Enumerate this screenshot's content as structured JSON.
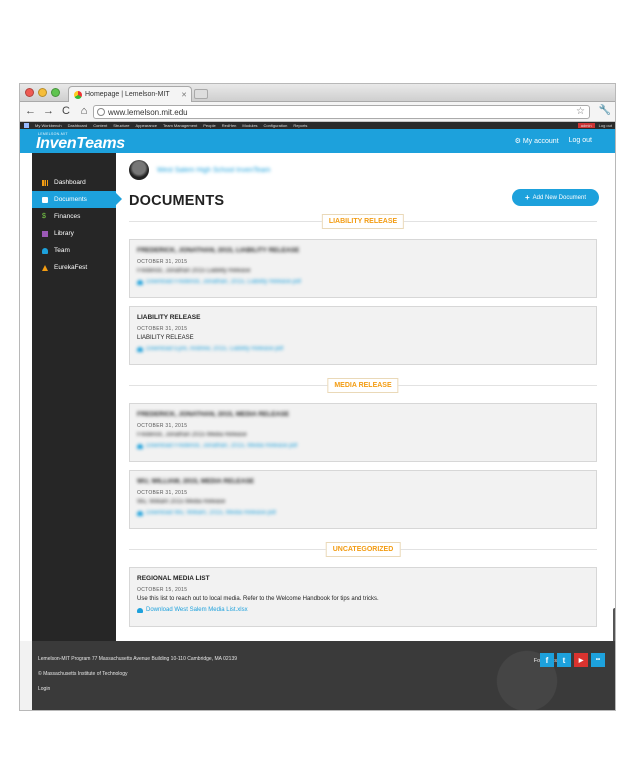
{
  "browser": {
    "tab_title": "Homepage | Lemelson-MIT",
    "url": "www.lemelson.mit.edu"
  },
  "admin_bar": {
    "items": [
      "My Workbench",
      "Dashboard",
      "Content",
      "Structure",
      "Appearance",
      "Team Management",
      "People",
      "RedHen",
      "Modules",
      "Configuration",
      "Reports"
    ],
    "user": "admin",
    "logout": "Log out"
  },
  "header": {
    "logo_small": "LEMELSON-MIT",
    "logo": "InvenTeams",
    "my_account": "My account",
    "logout": "Log out",
    "accent": "#1da1dc"
  },
  "sidebar": {
    "items": [
      {
        "label": "Dashboard",
        "icon": "chart-icon"
      },
      {
        "label": "Documents",
        "icon": "document-icon"
      },
      {
        "label": "Finances",
        "icon": "dollar-icon"
      },
      {
        "label": "Library",
        "icon": "book-icon"
      },
      {
        "label": "Team",
        "icon": "people-icon"
      },
      {
        "label": "EurekaFest",
        "icon": "flask-icon"
      }
    ]
  },
  "main": {
    "team_name": "West Salem High School InvenTeam",
    "page_title": "DOCUMENTS",
    "add_button": "Add New Document",
    "sections": {
      "liability": "LIABILITY RELEASE",
      "media": "MEDIA RELEASE",
      "uncategorized": "UNCATEGORIZED"
    },
    "cards": [
      {
        "title": "FREDERICK, JONATHAN, 2015, LIABILITY RELEASE",
        "date": "OCTOBER 31, 2015",
        "desc": "Frederick, Jonathan 2015 Liability Release",
        "link": "Download Frederick, Jonathan, 2015, Liability Release.pdf"
      },
      {
        "title": "LIABILITY RELEASE",
        "date": "OCTOBER 31, 2015",
        "desc": "LIABILITY RELEASE",
        "link": "Download Eyre, Andrew, 2015, Liability Release.pdf"
      },
      {
        "title": "FREDERICK, JONATHAN, 2015, MEDIA RELEASE",
        "date": "OCTOBER 31, 2015",
        "desc": "Frederick, Jonathan 2015 Media Release",
        "link": "Download Frederick, Jonathan, 2015, Media Release.pdf"
      },
      {
        "title": "WU, WILLIAM, 2015, MEDIA RELEASE",
        "date": "OCTOBER 31, 2015",
        "desc": "Wu, William 2015 Media Release",
        "link": "Download Wu, William, 2015, Media Release.pdf"
      },
      {
        "title": "REGIONAL MEDIA LIST",
        "date": "OCTOBER 15, 2015",
        "desc": "Use this list to reach out to local media. Refer to the Welcome Handbook for tips and tricks.",
        "link": "Download West Salem Media List.xlsx"
      }
    ]
  },
  "footer": {
    "address": "Lemelson-MIT Program 77 Massachusetts Avenue Building 10-110 Cambridge, MA 02139",
    "copyright": "© Massachusetts Institute of Technology",
    "login": "Login",
    "follow": "Follow us",
    "social": [
      {
        "icon": "facebook-icon",
        "glyph": "f",
        "color": "#1da1dc"
      },
      {
        "icon": "twitter-icon",
        "glyph": "t",
        "color": "#1da1dc"
      },
      {
        "icon": "youtube-icon",
        "glyph": "▶",
        "color": "#d9332f"
      },
      {
        "icon": "flickr-icon",
        "glyph": "••",
        "color": "#1da1dc"
      }
    ]
  }
}
